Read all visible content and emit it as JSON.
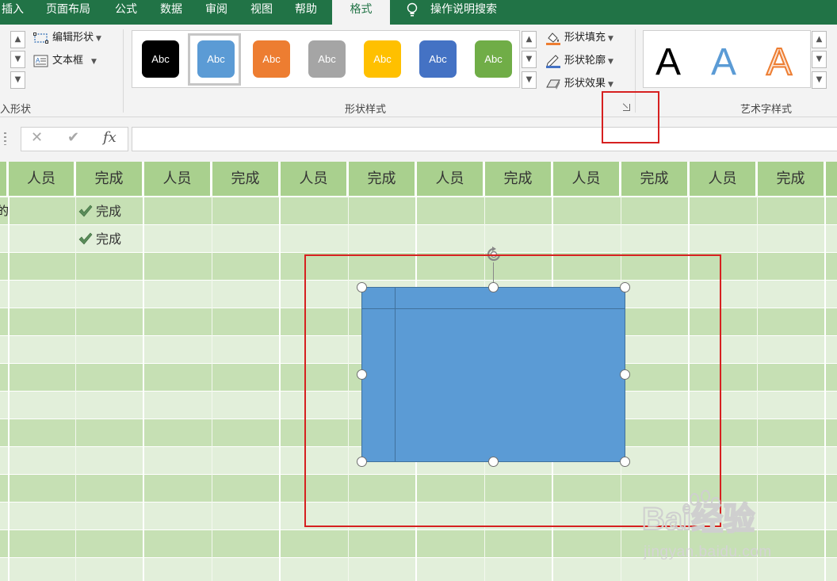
{
  "ribbon_tabs": [
    {
      "label": "插入"
    },
    {
      "label": "页面布局"
    },
    {
      "label": "公式"
    },
    {
      "label": "数据"
    },
    {
      "label": "审阅"
    },
    {
      "label": "视图"
    },
    {
      "label": "帮助"
    },
    {
      "label": "格式",
      "active": true
    },
    {
      "label": "操作说明搜索"
    }
  ],
  "insert_shapes_group": {
    "edit_shape_label": "编辑形状",
    "text_box_label": "文本框",
    "group_label": "入形状"
  },
  "shape_styles_group": {
    "swatch_text": "Abc",
    "swatches": [
      {
        "color": "#000000",
        "selected": false
      },
      {
        "color": "#5b9bd5",
        "selected": true
      },
      {
        "color": "#ed7d31",
        "selected": false
      },
      {
        "color": "#a5a5a5",
        "selected": false
      },
      {
        "color": "#ffc000",
        "selected": false
      },
      {
        "color": "#4472c4",
        "selected": false
      },
      {
        "color": "#70ad47",
        "selected": false
      }
    ],
    "fill_label": "形状填充",
    "outline_label": "形状轮廓",
    "effects_label": "形状效果",
    "group_label": "形状样式"
  },
  "wordart_group": {
    "letters": [
      "A",
      "A",
      "A"
    ],
    "group_label": "艺术字样式"
  },
  "formula_bar": {
    "cancel_icon": "✕",
    "enter_icon": "✔",
    "fx_label": "fx",
    "value": ""
  },
  "sheet": {
    "header_cells": [
      "人员",
      "完成",
      "人员",
      "完成",
      "人员",
      "完成",
      "人员",
      "完成",
      "人员",
      "完成",
      "人员",
      "完成"
    ],
    "left_clipped_text": "的",
    "check_rows": [
      "完成",
      "完成"
    ]
  },
  "colors": {
    "ribbon_green": "#217346",
    "header_fill": "#a9d08e",
    "band_dark": "#c6e0b4",
    "band_light": "#e2efda",
    "shape_fill": "#5b9bd5",
    "highlight_red": "#d62020"
  },
  "watermark": {
    "logo": "Bai经验",
    "url": "jingyan.baidu.com"
  }
}
